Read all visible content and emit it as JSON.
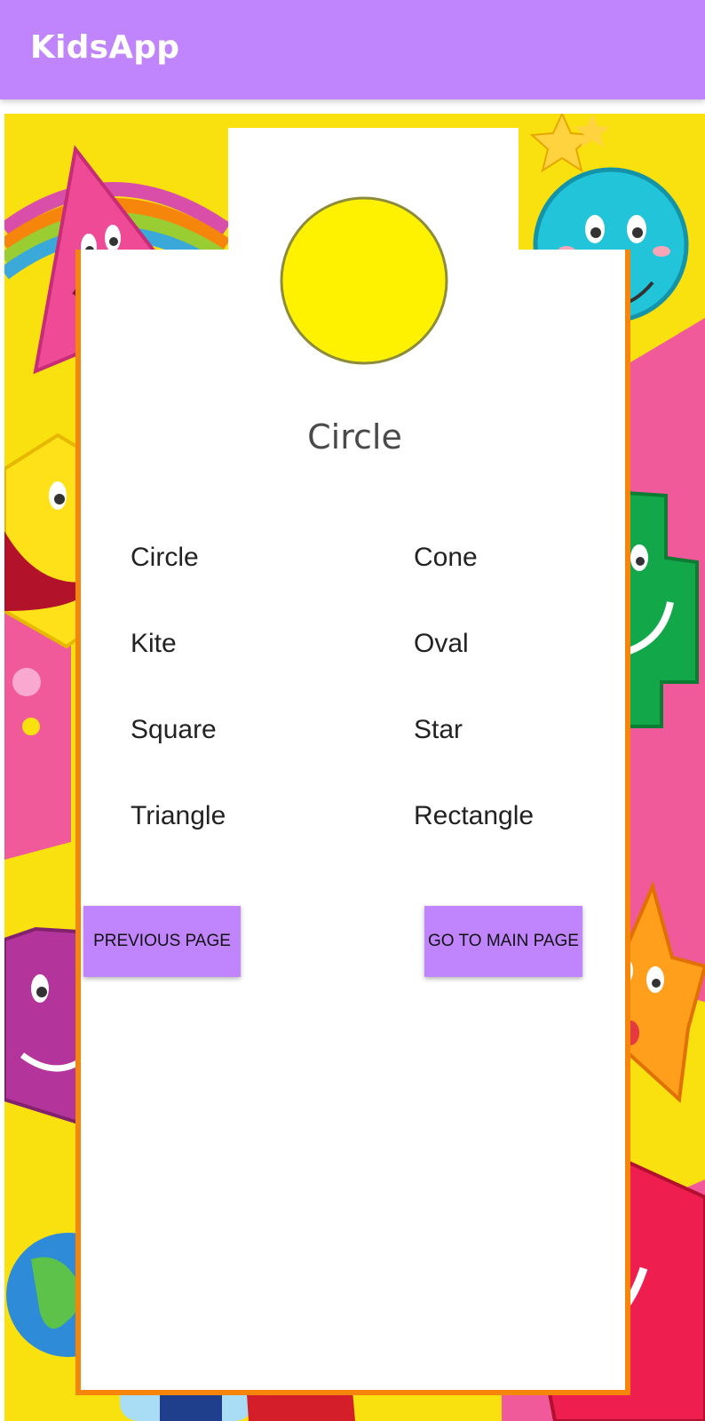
{
  "app": {
    "title": "KidsApp"
  },
  "shape": {
    "name": "Circle",
    "image": "circle-shape",
    "fill": "#FFF200",
    "stroke": "#8C8C3C"
  },
  "options": [
    {
      "label": "Circle"
    },
    {
      "label": "Cone"
    },
    {
      "label": "Kite"
    },
    {
      "label": "Oval"
    },
    {
      "label": "Square"
    },
    {
      "label": "Star"
    },
    {
      "label": "Triangle"
    },
    {
      "label": "Rectangle"
    }
  ],
  "buttons": {
    "previous": "PREVIOUS PAGE",
    "main": "GO TO MAIN PAGE"
  },
  "colors": {
    "appbar": "#C084FC",
    "frame": "#F9E10F",
    "border": "#F5860B",
    "button": "#C084FC"
  }
}
